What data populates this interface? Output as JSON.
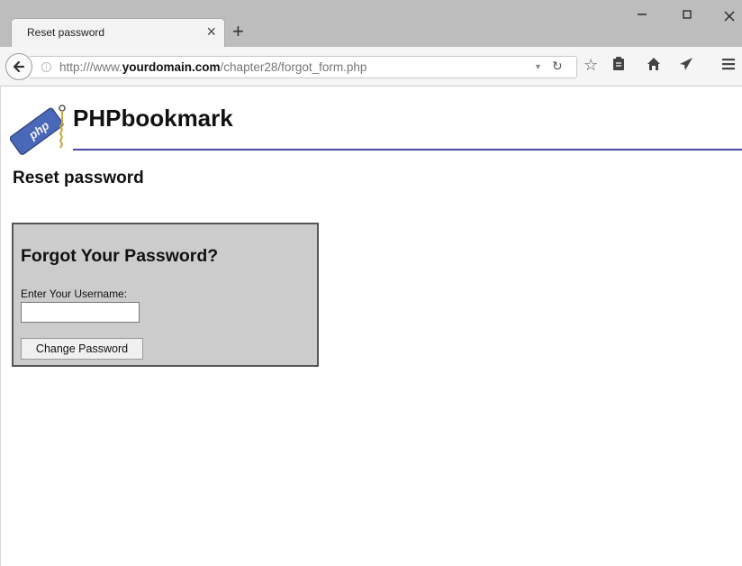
{
  "browser": {
    "tab_title": "Reset password",
    "tab_close": "×",
    "new_tab": "+",
    "url_prefix": "http:///www.",
    "url_domain": "yourdomain.com",
    "url_path": "/chapter28/forgot_form.php"
  },
  "site": {
    "logo_text": "php",
    "title": "PHPbookmark"
  },
  "page": {
    "heading": "Reset password"
  },
  "form": {
    "heading": "Forgot Your Password?",
    "username_label": "Enter Your Username:",
    "username_value": "",
    "submit_label": "Change Password"
  },
  "colors": {
    "header_rule": "#4a4a9e",
    "box_background": "#cccccc",
    "logo_blue": "#4a68b8"
  },
  "icons": [
    "back-arrow-icon",
    "info-icon",
    "reload-icon",
    "star-icon",
    "reading-list-icon",
    "home-icon",
    "send-icon",
    "menu-icon"
  ]
}
